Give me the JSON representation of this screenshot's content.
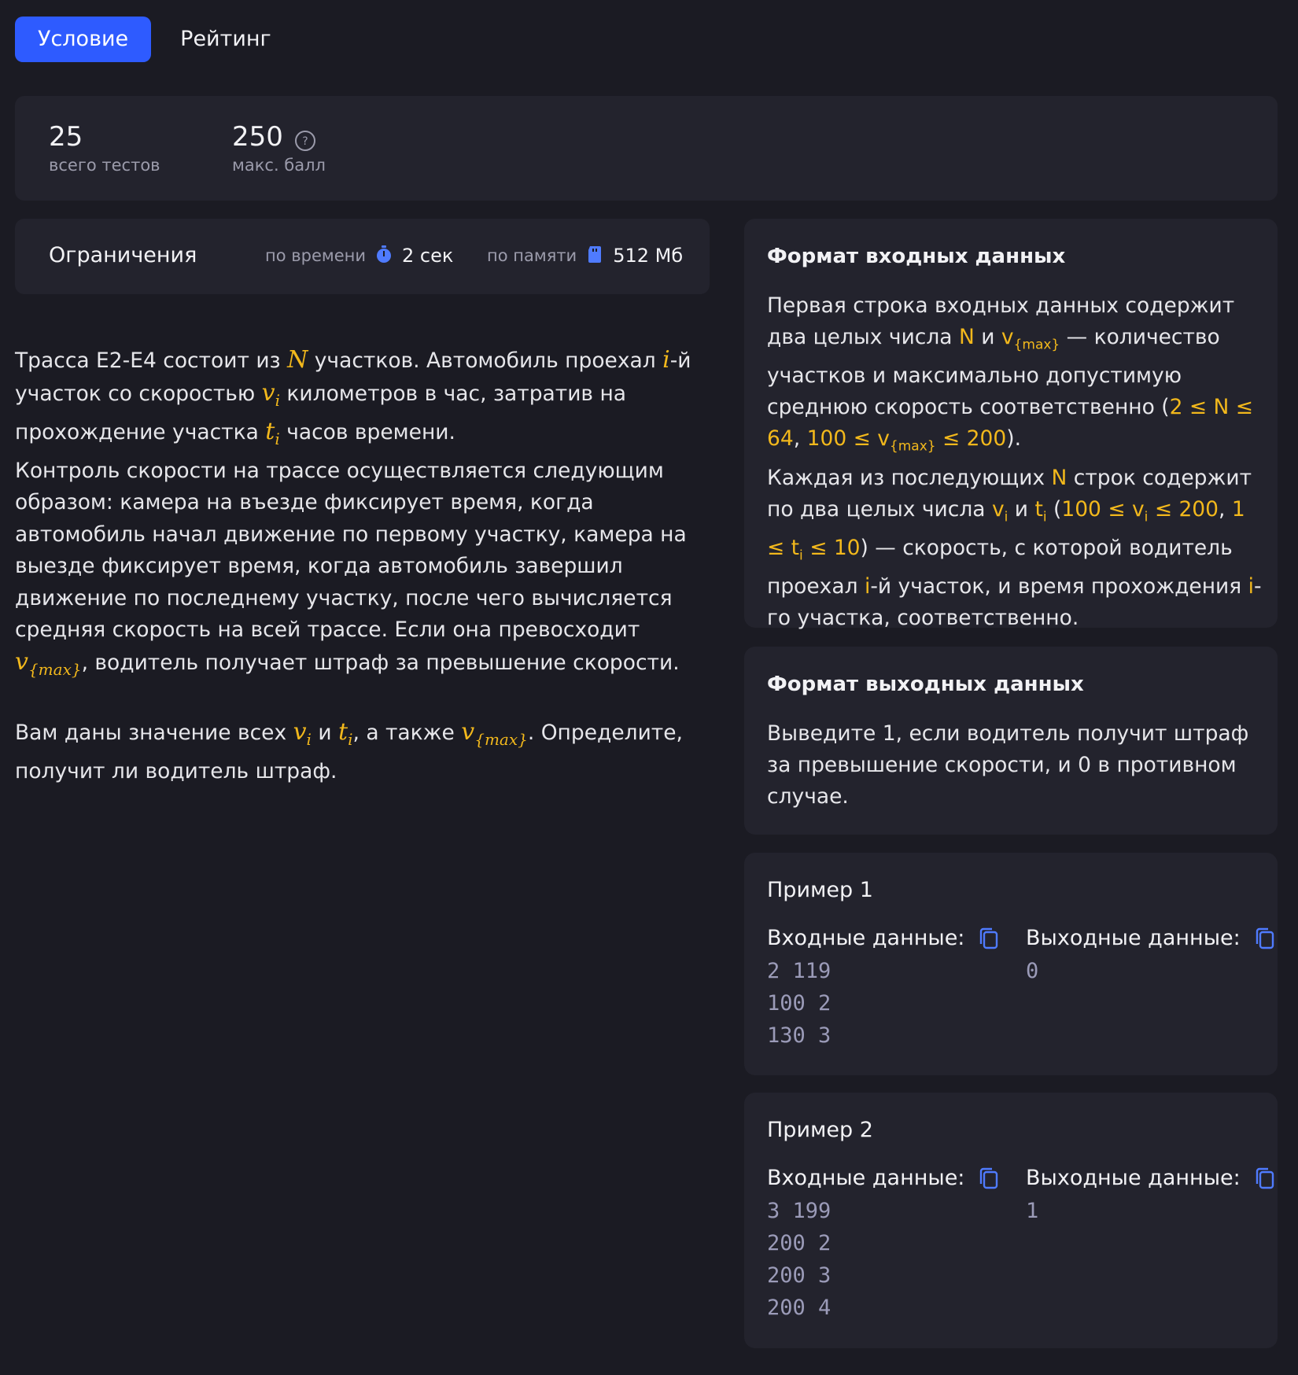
{
  "tabs": [
    {
      "label": "Условие",
      "active": true
    },
    {
      "label": "Рейтинг",
      "active": false
    }
  ],
  "stats": {
    "tests_value": "25",
    "tests_label": "всего тестов",
    "score_value": "250",
    "score_label": "макс. балл"
  },
  "limits": {
    "title": "Ограничения",
    "time_label": "по времени",
    "time_value": "2 сек",
    "memory_label": "по памяти",
    "memory_value": "512 Мб"
  },
  "statement": {
    "p1": [
      "Трасса E2-E4 состоит из ",
      "N",
      " участков. Автомобиль проехал ",
      "i",
      "-й участок со скоростью ",
      "v",
      "i",
      " километров в час, затратив на прохождение участка ",
      "t",
      "i",
      " часов времени."
    ],
    "p2": "Контроль скорости на трассе осуществляется следующим образом: камера на въезде фиксирует время, когда автомобиль начал движение по первому участку, камера на выезде фиксирует время, когда автомобиль завершил движение по последнему участку, после чего вычисляется средняя скорость на всей трассе. Если она превосходит ",
    "p2_var": "v",
    "p2_sub": "{max}",
    "p2_end": ", водитель получает штраф за превышение скорости.",
    "p3_a": "Вам даны значение всех ",
    "p3_v": "v",
    "p3_vi": "i",
    "p3_b": " и ",
    "p3_t": "t",
    "p3_ti": "i",
    "p3_c": ", а также ",
    "p3_vmax": "v",
    "p3_vmax_sub": "{max}",
    "p3_d": ". Определите, получит ли водитель штраф."
  },
  "input_format": {
    "title": "Формат входных данных",
    "t1": "Первая строка входных данных содержит два целых числа ",
    "y1": "N",
    "t2": " и ",
    "y2": "v",
    "y2sub": "{max}",
    "t3": " — количество участков и максимально допустимую среднюю скорость соответственно (",
    "y3": "2 ≤ N ≤ 64",
    "t4": ", ",
    "y4a": "100 ≤ v",
    "y4sub": "{max}",
    "y4b": " ≤ 200",
    "t5": ").",
    "t6": "Каждая из последующих ",
    "y6": "N",
    "t7": " строк содержит по два целых числа ",
    "y7": "v",
    "y7sub": "i",
    "t8": " и ",
    "y8": "t",
    "y8sub": "i",
    "t9": " (",
    "y9a": "100 ≤ v",
    "y9sub": "i",
    "y9b": " ≤ 200",
    "t10": ", ",
    "y10a": "1 ≤ t",
    "y10sub": "i",
    "y10b": " ≤ 10",
    "t11": ") — скорость, с которой водитель проехал ",
    "y11": "i",
    "t12": "-й участок, и время прохождения ",
    "y12": "i",
    "t13": "-го участка, соответственно."
  },
  "output_format": {
    "title": "Формат выходных данных",
    "text": "Выведите 1, если водитель получит штраф за превышение скорости, и 0 в противном случае."
  },
  "examples": [
    {
      "title": "Пример 1",
      "input_label": "Входные данные:",
      "output_label": "Выходные данные:",
      "input": "2 119\n100 2\n130 3",
      "output": "0"
    },
    {
      "title": "Пример 2",
      "input_label": "Входные данные:",
      "output_label": "Выходные данные:",
      "input": "3 199\n200 2\n200 3\n200 4",
      "output": "1"
    }
  ],
  "colors": {
    "accent": "#2e5bff",
    "highlight": "#f2b81c",
    "background": "#1b1b23",
    "card": "#23232d"
  },
  "icons": [
    "help-icon",
    "stopwatch-icon",
    "memory-card-icon",
    "copy-icon"
  ]
}
